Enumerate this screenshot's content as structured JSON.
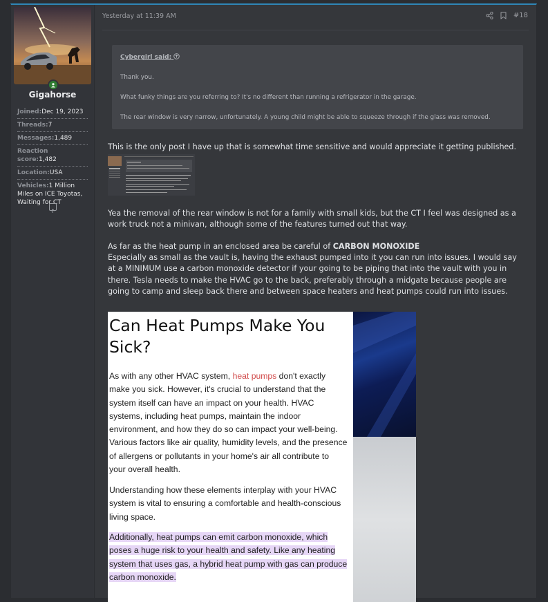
{
  "user": {
    "username": "Gigahorse",
    "stats": [
      {
        "key": "Joined:",
        "value": "Dec 19, 2023"
      },
      {
        "key": "Threads:",
        "value": "7"
      },
      {
        "key": "Messages:",
        "value": "1,489"
      },
      {
        "key": "Reaction score:",
        "value": "1,482"
      },
      {
        "key": "Location:",
        "value": "USA"
      },
      {
        "key": "Vehicles:",
        "value": "1 Million Miles on ICE Toyotas, Waiting for CT"
      }
    ]
  },
  "post": {
    "timestamp": "Yesterday at 11:39 AM",
    "number": "#18",
    "quote": {
      "author": "Cybergirl said:",
      "lines": [
        "Thank you.",
        "What funky things are you referring to? It's no different than running a refrigerator in the garage.",
        "The rear window is very narrow, unfortunately. A young child might be able to squeeze through if the glass was removed."
      ]
    },
    "intro": "This is the only post I have up that is somewhat time sensitive and would appreciate it getting published.",
    "para1": "Yea the removal of the rear window is not for a family with small kids, but the CT I feel was designed as a work truck not a minivan, although some of the features turned out that way.",
    "para2_prefix": "As far as the heat pump in an enclosed area be careful of ",
    "para2_bold": "CARBON MONOXIDE",
    "para2_rest": "Especially as small as the vault is, having the exhaust pumped into it you can run into issues. I would say at a MINIMUM use a carbon monoxide detector if your going to be piping that into the vault with you in there. Tesla needs to make the HVAC go to the back, preferably through a midgate because people are going to camp and sleep back there and between space heaters and heat pumps could run into issues."
  },
  "article": {
    "heading": "Can Heat Pumps Make You Sick?",
    "p1_a": "As with any other HVAC system, ",
    "p1_link": "heat pumps",
    "p1_b": " don't exactly make you sick. However, it's crucial to understand that the system itself can have an impact on your health. HVAC systems, including heat pumps, maintain the indoor environment, and how they do so can impact your well-being. Various factors like air quality, humidity levels, and the presence of allergens or pollutants in your home's air all contribute to your overall health.",
    "p2": "Understanding how these elements interplay with your HVAC system is vital to ensuring a comfortable and health-conscious living space.",
    "p3": "Additionally, heat pumps can emit carbon monoxide, which poses a huge risk to your health and safety. Like any heating system that uses gas, a hybrid heat pump with gas can produce carbon monoxide."
  },
  "colors": {
    "accent": "#2f86b7",
    "online": "#2e7d32",
    "highlight": "#e6d6f6",
    "link": "#d14b4b"
  }
}
